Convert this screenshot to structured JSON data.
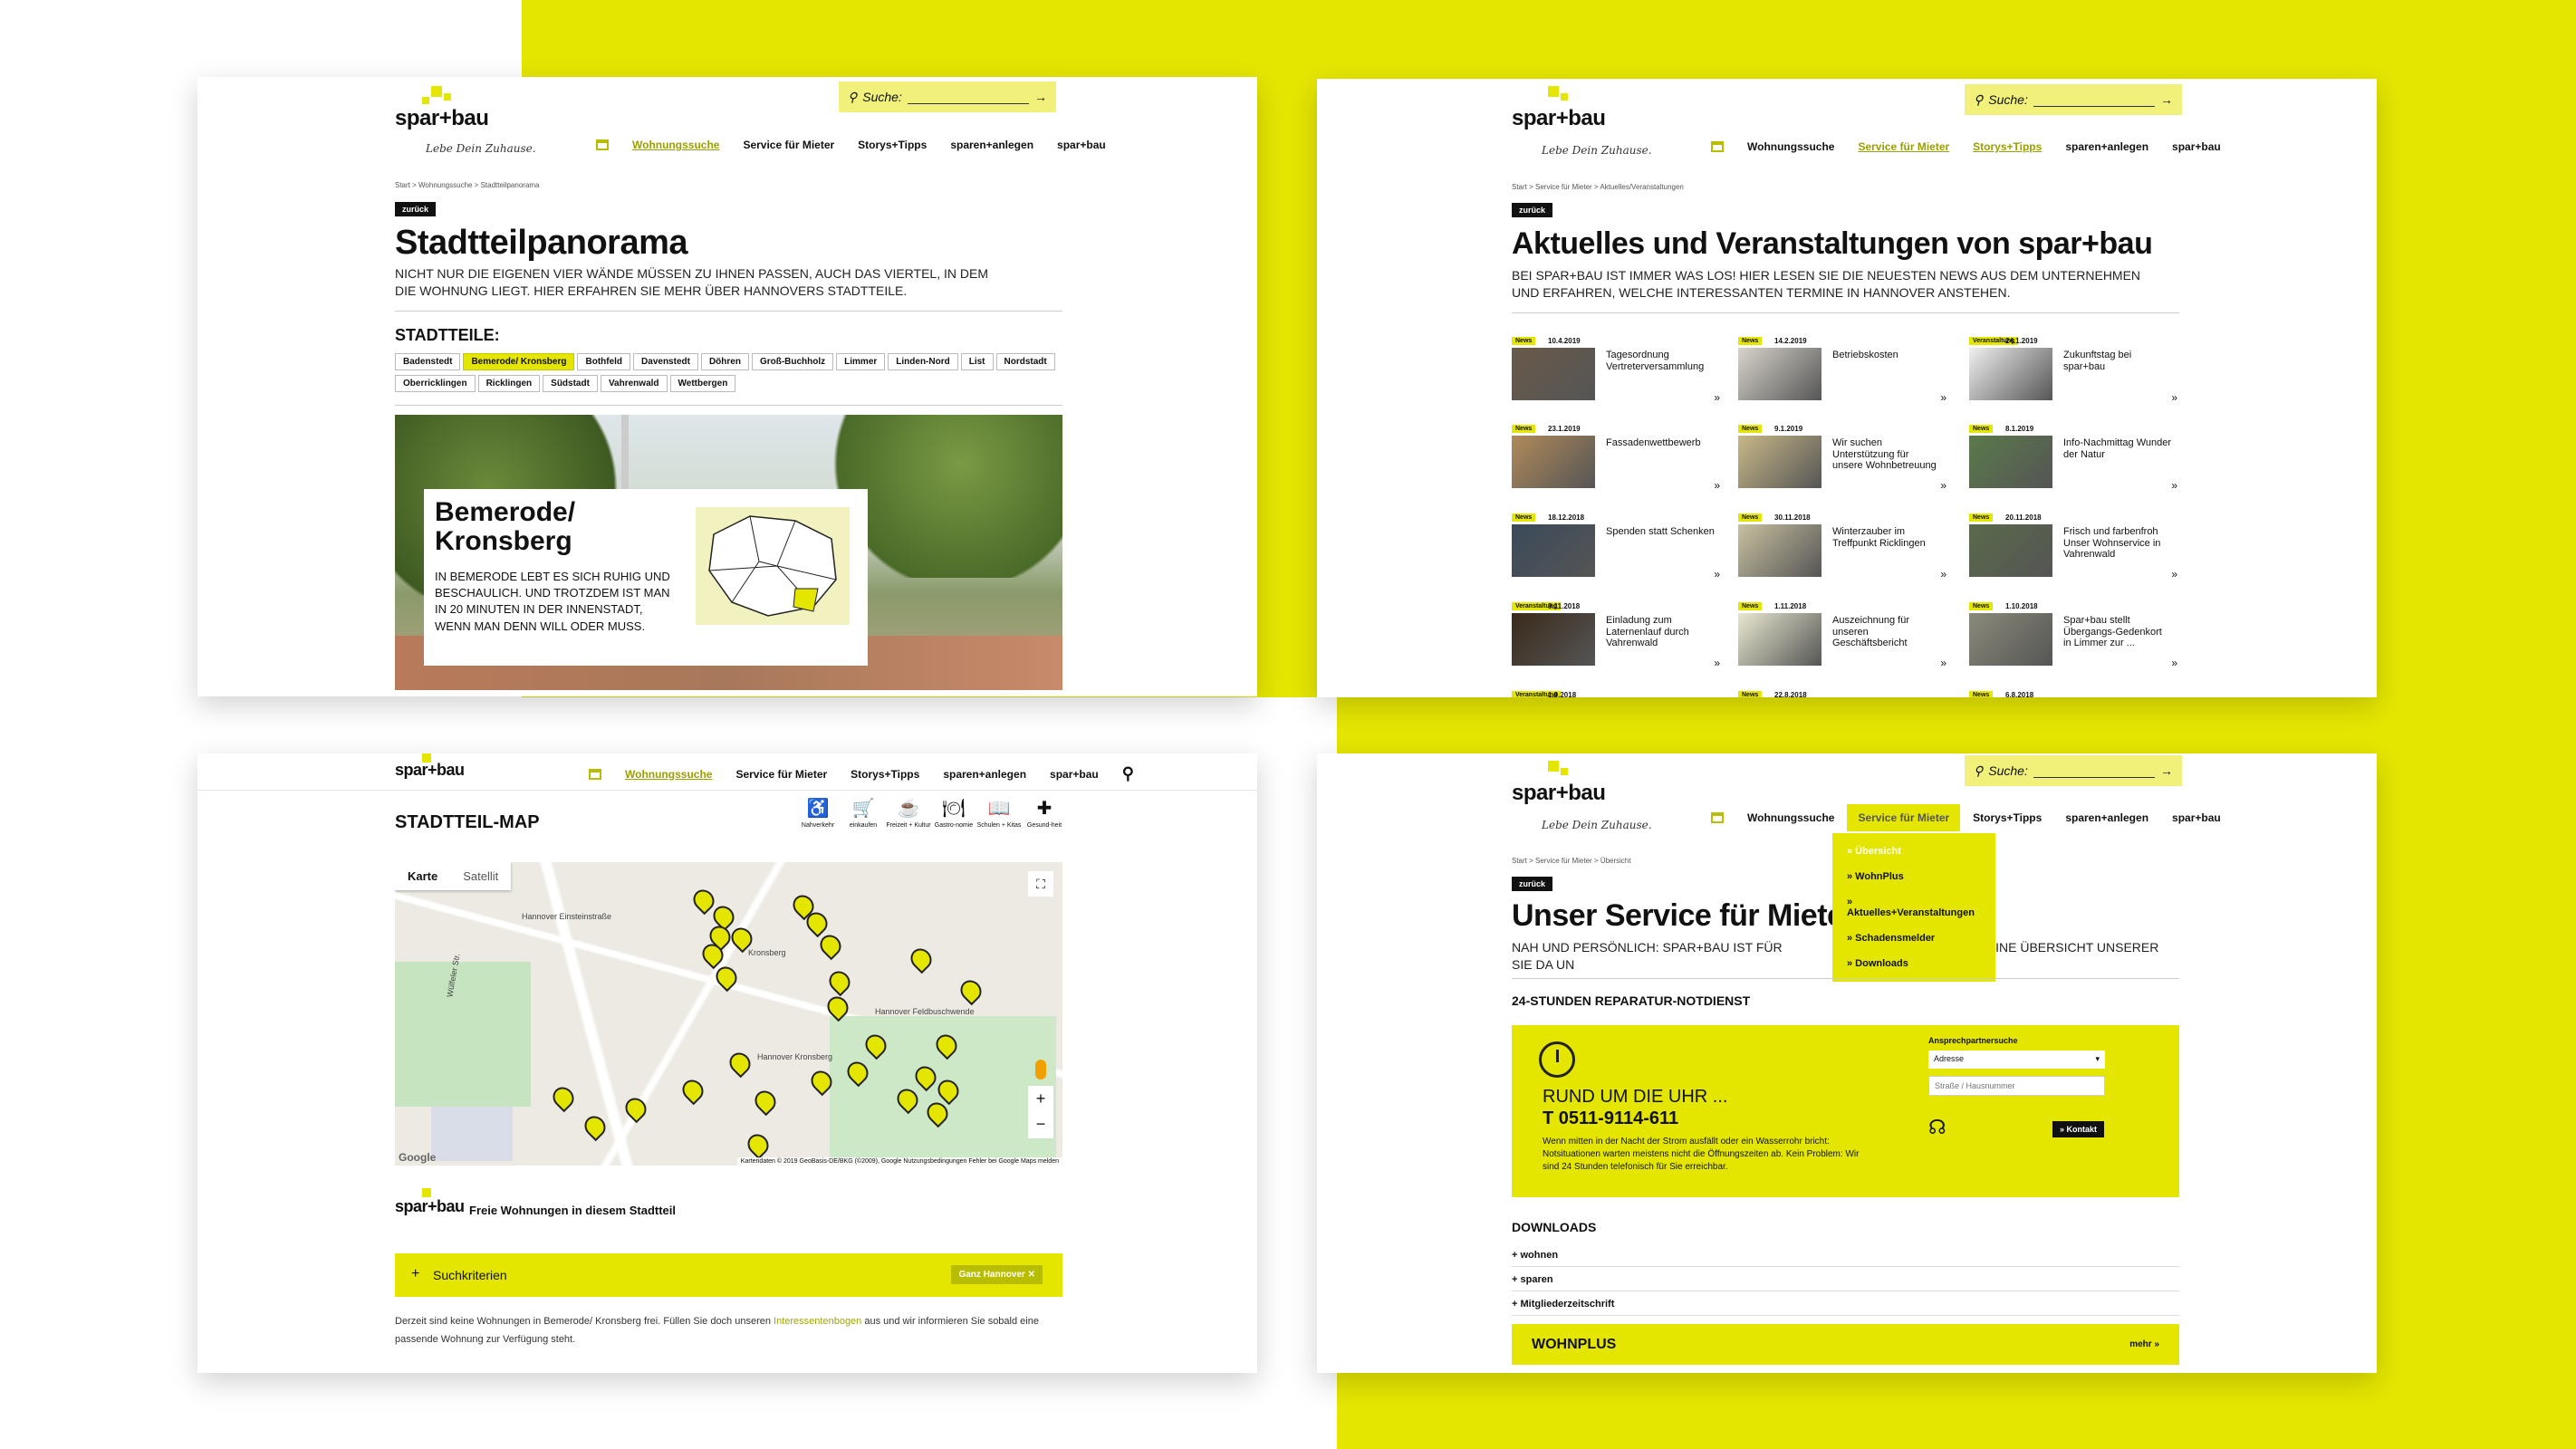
{
  "panel1": {
    "logo": "spar+bau",
    "tagline": "Lebe Dein Zuhause.",
    "search_label": "Suche:",
    "nav": [
      "Wohnungssuche",
      "Service für Mieter",
      "Storys+Tipps",
      "sparen+anlegen",
      "spar+bau"
    ],
    "breadcrumb": "Start  >  Wohnungssuche  >  Stadtteilpanorama",
    "back": "zurück",
    "title": "Stadtteilpanorama",
    "subtitle": "Nicht nur die eigenen vier Wände müssen zu Ihnen passen, auch das Viertel, in dem die Wohnung liegt. Hier erfahren Sie mehr über Hannovers Stadtteile.",
    "districts_label": "STADTTEILE:",
    "districts": [
      "Badenstedt",
      "Bemerode/ Kronsberg",
      "Bothfeld",
      "Davenstedt",
      "Döhren",
      "Groß-Buchholz",
      "Limmer",
      "Linden-Nord",
      "List",
      "Nordstadt",
      "Oberricklingen",
      "Ricklingen",
      "Südstadt",
      "Vahrenwald",
      "Wettbergen"
    ],
    "card_title": "Bemerode/ Kronsberg",
    "card_text": "In Bemerode lebt es sich ruhig und beschaulich. Und trotzdem ist man in 20 Minuten in der Innenstadt, wenn man denn will oder muss."
  },
  "panel2": {
    "logo": "spar+bau",
    "tagline": "Lebe Dein Zuhause.",
    "search_label": "Suche:",
    "nav": [
      "Wohnungssuche",
      "Service für Mieter",
      "Storys+Tipps",
      "sparen+anlegen",
      "spar+bau"
    ],
    "breadcrumb": "Start  >  Service für Mieter  >  Aktuelles/Veranstaltungen",
    "back": "zurück",
    "title": "Aktuelles und Veranstaltungen von spar+bau",
    "subtitle": "Bei spar+bau ist immer was los! Hier lesen Sie die neuesten News aus dem Unternehmen und erfahren, welche interessanten Termine in Hannover anstehen.",
    "items": [
      {
        "badge": "News",
        "date": "10.4.2019",
        "title": "Tagesordnung Vertreterversammlung"
      },
      {
        "badge": "News",
        "date": "14.2.2019",
        "title": "Betriebskosten"
      },
      {
        "badge": "Veranstaltung",
        "date": "24.1.2019",
        "title": "Zukunftstag bei spar+bau"
      },
      {
        "badge": "News",
        "date": "23.1.2019",
        "title": "Fassadenwettbewerb"
      },
      {
        "badge": "News",
        "date": "9.1.2019",
        "title": "Wir suchen Unterstützung für unsere Wohnbetreuung"
      },
      {
        "badge": "News",
        "date": "8.1.2019",
        "title": "Info-Nachmittag Wunder der Natur"
      },
      {
        "badge": "News",
        "date": "18.12.2018",
        "title": "Spenden statt Schenken"
      },
      {
        "badge": "News",
        "date": "30.11.2018",
        "title": "Winterzauber im Treffpunkt Ricklingen"
      },
      {
        "badge": "News",
        "date": "20.11.2018",
        "title": "Frisch und farbenfroh Unser Wohnservice in Vahrenwald"
      },
      {
        "badge": "Veranstaltung",
        "date": "9.11.2018",
        "title": "Einladung zum Laternenlauf durch Vahrenwald"
      },
      {
        "badge": "News",
        "date": "1.11.2018",
        "title": "Auszeichnung für unseren Geschäftsbericht"
      },
      {
        "badge": "News",
        "date": "1.10.2018",
        "title": "Spar+bau stellt Übergangs-Gedenkort in Limmer zur ..."
      }
    ],
    "more_row": [
      {
        "badge": "Veranstaltung",
        "date": "1.9.2018"
      },
      {
        "badge": "News",
        "date": "22.8.2018"
      },
      {
        "badge": "News",
        "date": "6.8.2018"
      }
    ]
  },
  "panel3": {
    "logo": "spar+bau",
    "nav": [
      "Wohnungssuche",
      "Service für Mieter",
      "Storys+Tipps",
      "sparen+anlegen",
      "spar+bau"
    ],
    "title": "STADTTEIL-MAP",
    "categories": [
      "Nahverkehr",
      "einkaufen",
      "Freizeit + Kultur",
      "Gastro-nomie",
      "Schulen + Kitas",
      "Gesund-heit"
    ],
    "map_tabs": [
      "Karte",
      "Satellit"
    ],
    "map_labels": [
      "Hannover Einsteinstraße",
      "Kronsberg",
      "Hannover Feldbuschwende",
      "Hannover Kronsberg",
      "Wülfeler Str."
    ],
    "map_footer": "Kartendaten © 2019 GeoBasis-DE/BKG (©2009), Google  Nutzungsbedingungen  Fehler bei Google Maps melden",
    "google": "Google",
    "free_title": "Freie Wohnungen in diesem Stadtteil",
    "criteria": "Suchkriterien",
    "filter_chip": "Ganz Hannover",
    "note_pre": "Derzeit sind keine Wohnungen in Bemerode/ Kronsberg frei. Füllen Sie doch unseren ",
    "note_link": "Interessentenbogen",
    "note_post": " aus und wir informieren Sie sobald eine passende Wohnung zur Verfügung steht."
  },
  "panel4": {
    "logo": "spar+bau",
    "tagline": "Lebe Dein Zuhause.",
    "search_label": "Suche:",
    "nav": [
      "Wohnungssuche",
      "Service für Mieter",
      "Storys+Tipps",
      "sparen+anlegen",
      "spar+bau"
    ],
    "dropdown": [
      "Übersicht",
      "WohnPlus",
      "Aktuelles+Veranstaltungen",
      "Schadensmelder",
      "Downloads"
    ],
    "breadcrumb": "Start  >  Service für Mieter  >  Übersicht",
    "back": "zurück",
    "title": "Unser Service für Mieter",
    "subtitle_a": "Nah und persönlich: spar+bau ist für Sie da un",
    "subtitle_b": "hier finden Sie eine Übersicht unserer Leistungen.",
    "emergency_heading": "24-STUNDEN REPARATUR-NOTDIENST",
    "clock_title": "RUND UM DIE UHR ...",
    "phone": "T 0511-9114-611",
    "emergency_text": "Wenn mitten in der Nacht der Strom ausfällt oder ein Wasserrohr bricht: Notsituationen warten meistens nicht die Öffnungszeiten ab. Kein Problem: Wir sind 24 Stunden telefonisch für Sie erreichbar.",
    "contact_search_label": "Ansprechpartnersuche",
    "select_value": "Adresse",
    "street_placeholder": "Straße / Hausnummer",
    "contact_button": "Kontakt",
    "downloads_heading": "DOWNLOADS",
    "downloads": [
      "wohnen",
      "sparen",
      "Mitgliederzeitschrift"
    ],
    "wohnplus": "WOHNPLUS",
    "more": "mehr"
  }
}
